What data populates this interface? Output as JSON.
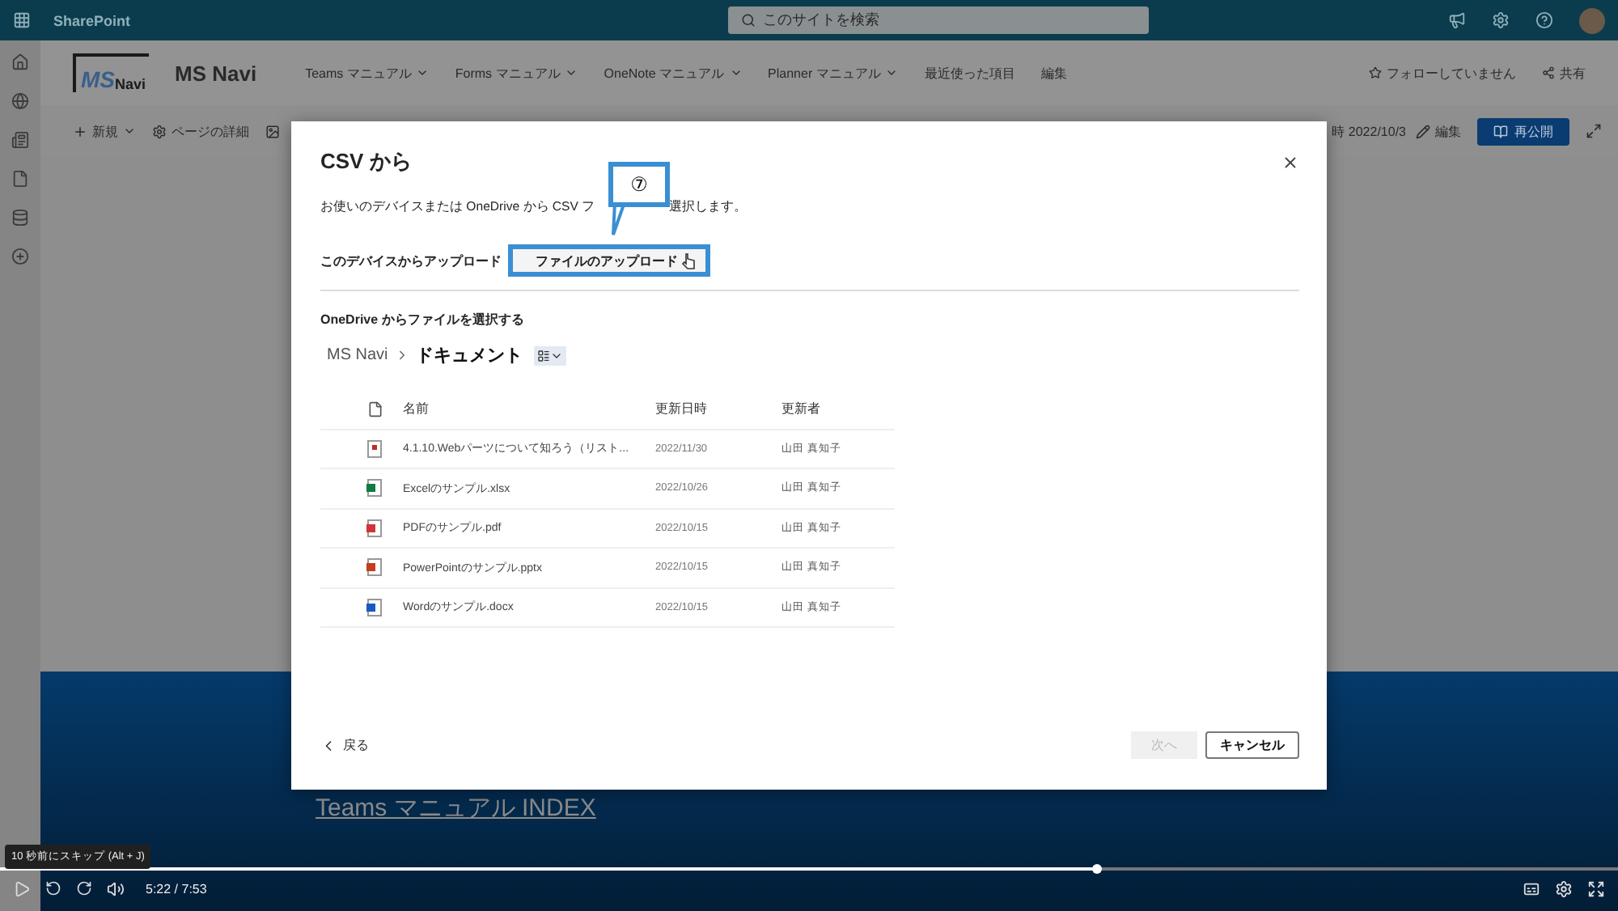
{
  "app_bar": {
    "brand": "SharePoint",
    "search_placeholder": "このサイトを検索"
  },
  "site": {
    "logo_main": "MS",
    "logo_sub": "Navi",
    "title": "MS Navi",
    "nav": [
      {
        "label": "Teams マニュアル",
        "dropdown": true
      },
      {
        "label": "Forms マニュアル",
        "dropdown": true
      },
      {
        "label": "OneNote マニュアル",
        "dropdown": true
      },
      {
        "label": "Planner マニュアル",
        "dropdown": true
      },
      {
        "label": "最近使った項目",
        "dropdown": false
      },
      {
        "label": "編集",
        "dropdown": false
      }
    ],
    "follow": "フォローしていません",
    "share": "共有"
  },
  "command_bar": {
    "new": "新規",
    "page_details": "ページの詳細",
    "published": "時 2022/10/3",
    "edit": "編集",
    "republish": "再公開"
  },
  "dialog": {
    "title": "CSV から",
    "description_start": "お使いのデバイスまたは OneDrive から CSV フ",
    "description_end": "選択します。",
    "upload_label": "このデバイスからアップロード",
    "upload_button": "ファイルのアップロード",
    "callout": "⑦",
    "onedrive_heading": "OneDrive からファイルを選択する",
    "breadcrumb": [
      "MS Navi",
      "ドキュメント"
    ],
    "columns": [
      "名前",
      "更新日時",
      "更新者"
    ],
    "files": [
      {
        "kind": "video",
        "name": "4.1.10.Webパーツについて知ろう（リスト...",
        "date": "2022/11/30",
        "author": "山田 真知子"
      },
      {
        "kind": "excel",
        "name": "Excelのサンプル.xlsx",
        "date": "2022/10/26",
        "author": "山田 真知子"
      },
      {
        "kind": "pdf",
        "name": "PDFのサンプル.pdf",
        "date": "2022/10/15",
        "author": "山田 真知子"
      },
      {
        "kind": "powerpoint",
        "name": "PowerPointのサンプル.pptx",
        "date": "2022/10/15",
        "author": "山田 真知子"
      },
      {
        "kind": "word",
        "name": "Wordのサンプル.docx",
        "date": "2022/10/15",
        "author": "山田 真知子"
      }
    ],
    "back": "戻る",
    "next": {
      "label": "次へ",
      "disabled": true
    },
    "cancel": "キャンセル"
  },
  "page_heading": "Teams マニュアル INDEX",
  "player": {
    "tooltip": "10 秒前にスキップ (Alt + J)",
    "time": "5:22 / 7:53",
    "level": 0.678
  }
}
